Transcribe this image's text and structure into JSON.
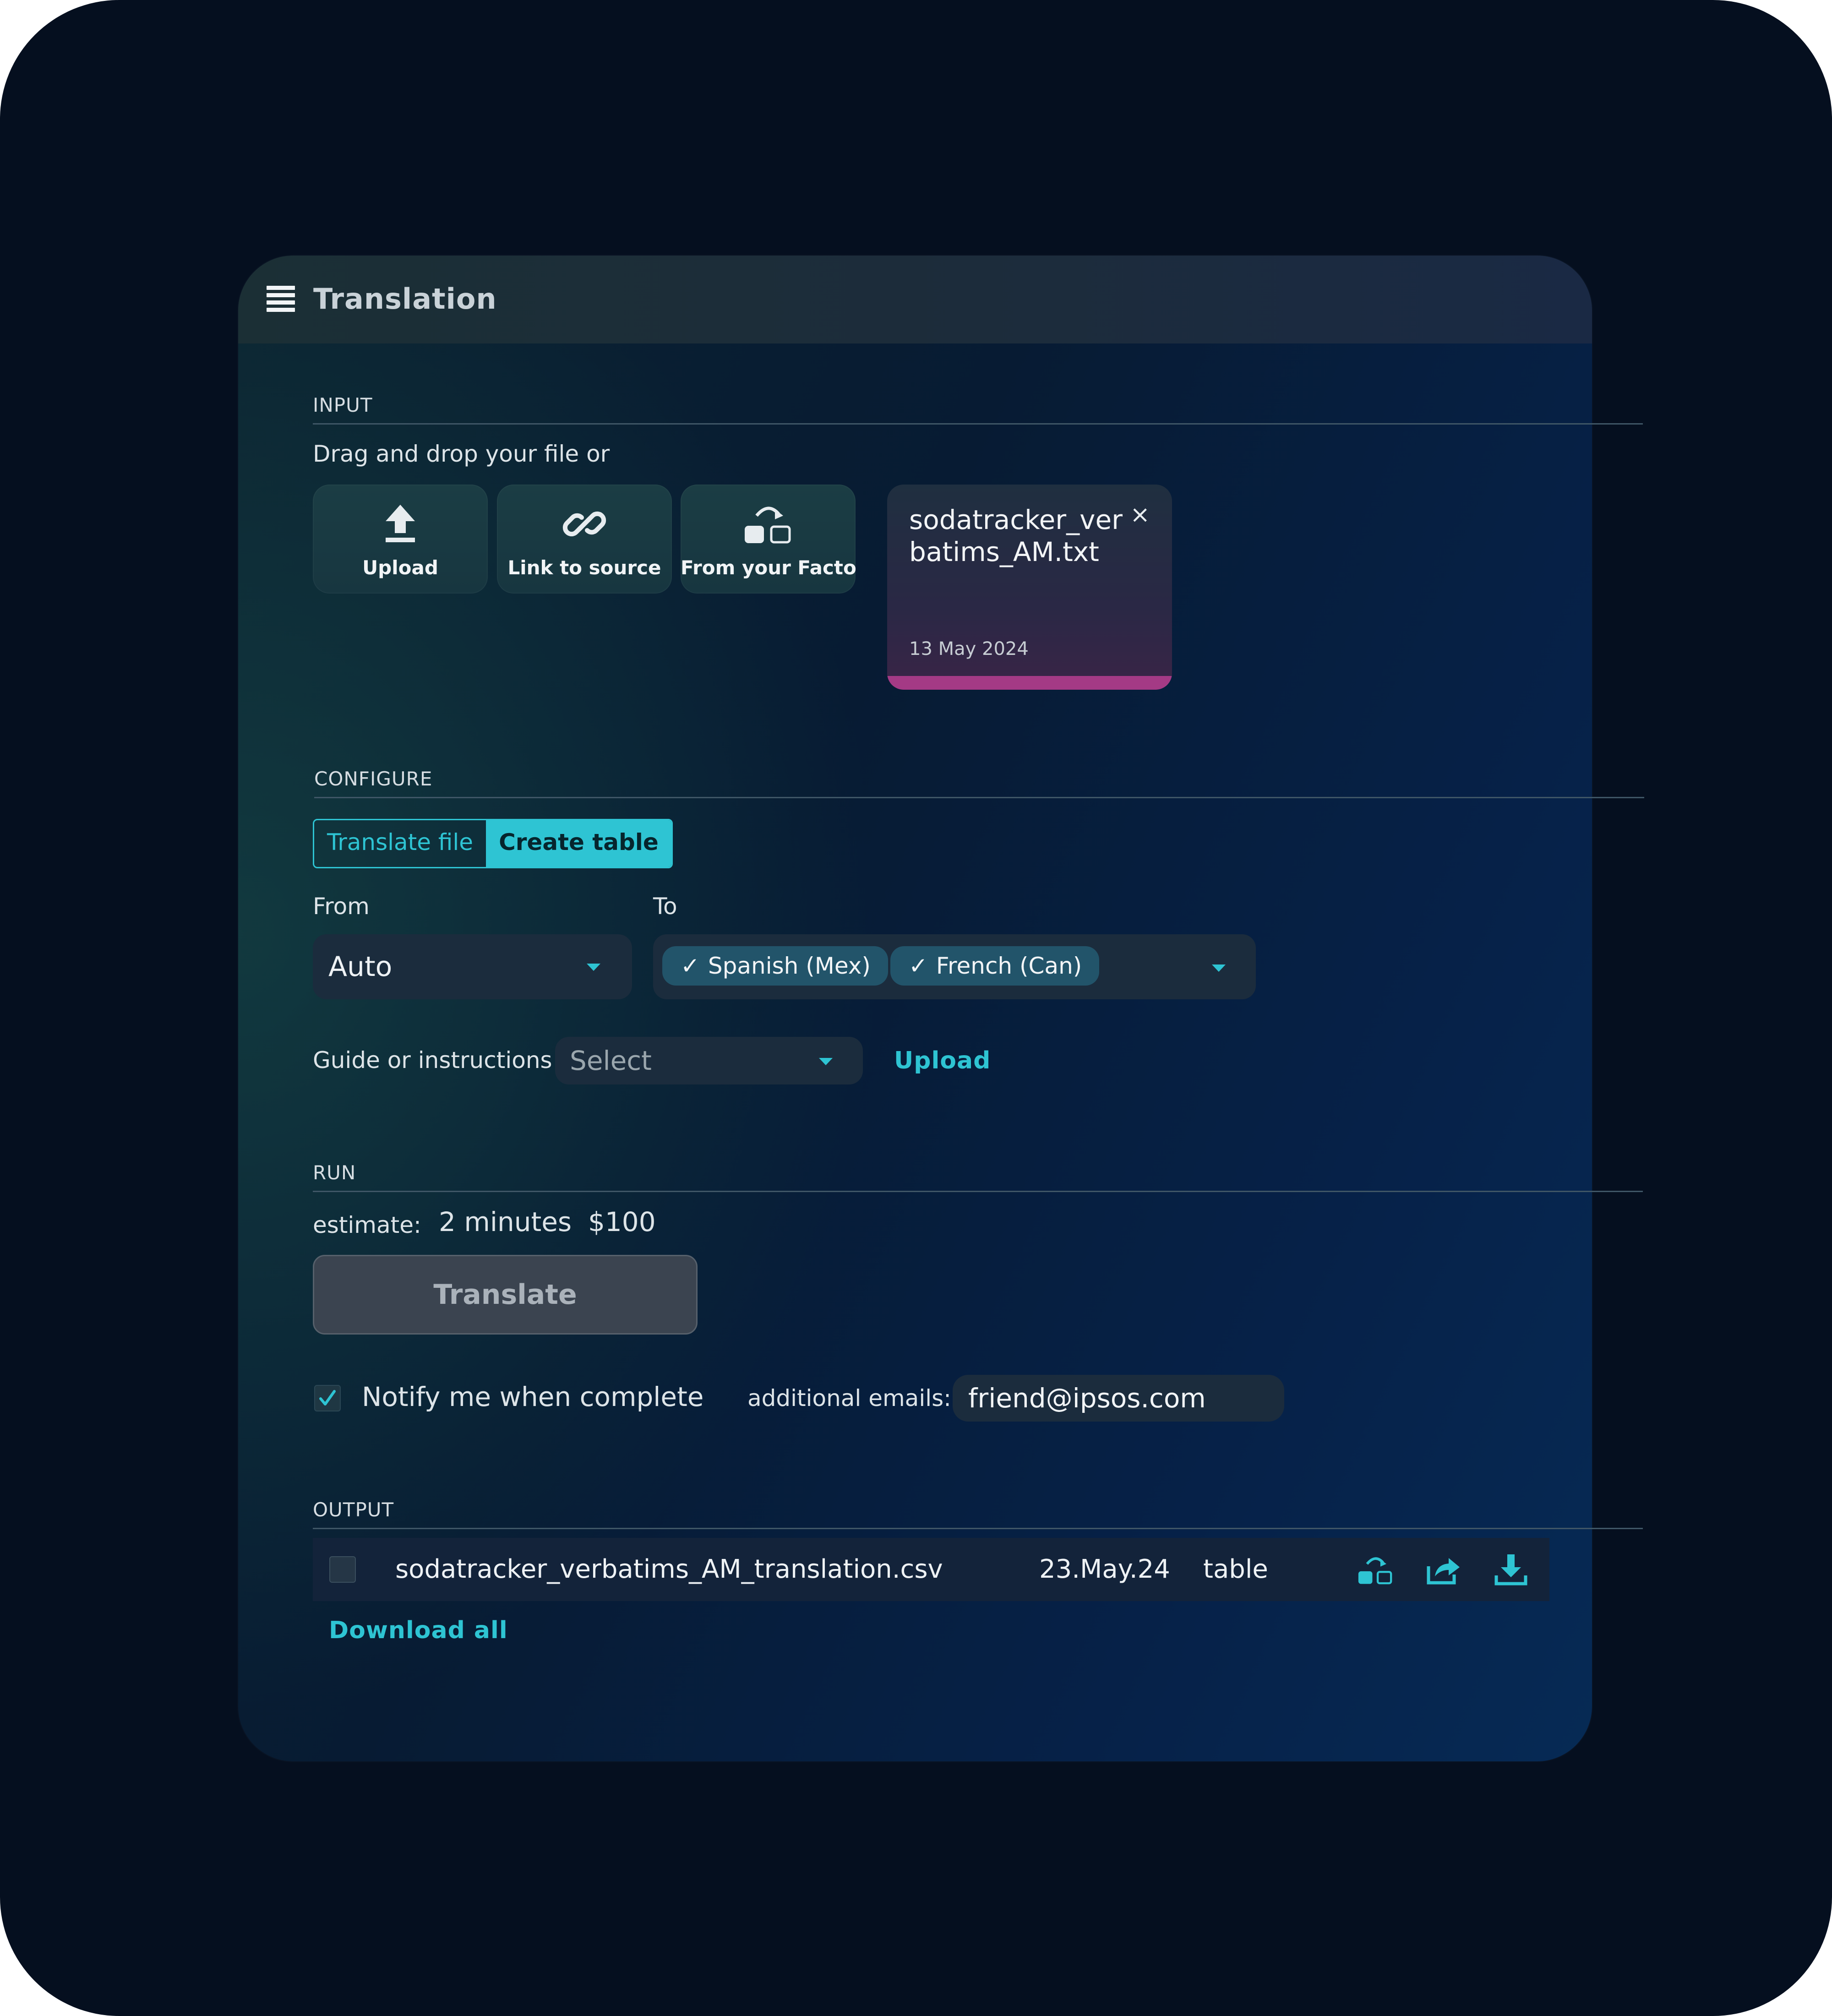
{
  "window": {
    "title": "Translation"
  },
  "input": {
    "section_label": "INPUT",
    "drag_drop_text": "Drag and drop your file or",
    "tiles": [
      {
        "label": "Upload",
        "icon": "upload-icon"
      },
      {
        "label": "Link to source",
        "icon": "link-icon"
      },
      {
        "label": "From your Facto",
        "icon": "factory-icon"
      }
    ],
    "file": {
      "name": "sodatracker_verbatims_AM.txt",
      "date": "13 May 2024",
      "close_symbol": "×"
    }
  },
  "configure": {
    "section_label": "CONFIGURE",
    "mode_toggle": {
      "options": [
        "Translate file",
        "Create table"
      ],
      "selected": "Create table"
    },
    "from": {
      "label": "From",
      "value": "Auto"
    },
    "to": {
      "label": "To",
      "selected": [
        "Spanish (Mex)",
        "French (Can)"
      ]
    },
    "guide": {
      "label": "Guide or instructions",
      "placeholder": "Select",
      "upload_label": "Upload"
    }
  },
  "run": {
    "section_label": "RUN",
    "estimate_label": "estimate:",
    "estimate_time": "2 minutes",
    "estimate_cost": "$100",
    "translate_button": "Translate",
    "notify": {
      "label": "Notify me when complete",
      "checked": true
    },
    "additional_emails": {
      "label": "additional emails:",
      "value": "friend@ipsos.com"
    }
  },
  "output": {
    "section_label": "OUTPUT",
    "rows": [
      {
        "filename": "sodatracker_verbatims_AM_translation.csv",
        "date": "23.May.24",
        "type": "table",
        "checked": false
      }
    ],
    "download_all": "Download all"
  },
  "colors": {
    "accent": "#2ec4d3",
    "background": "#050f1f",
    "file_progress": "#a43a85"
  },
  "icons": {
    "check": "✓"
  }
}
